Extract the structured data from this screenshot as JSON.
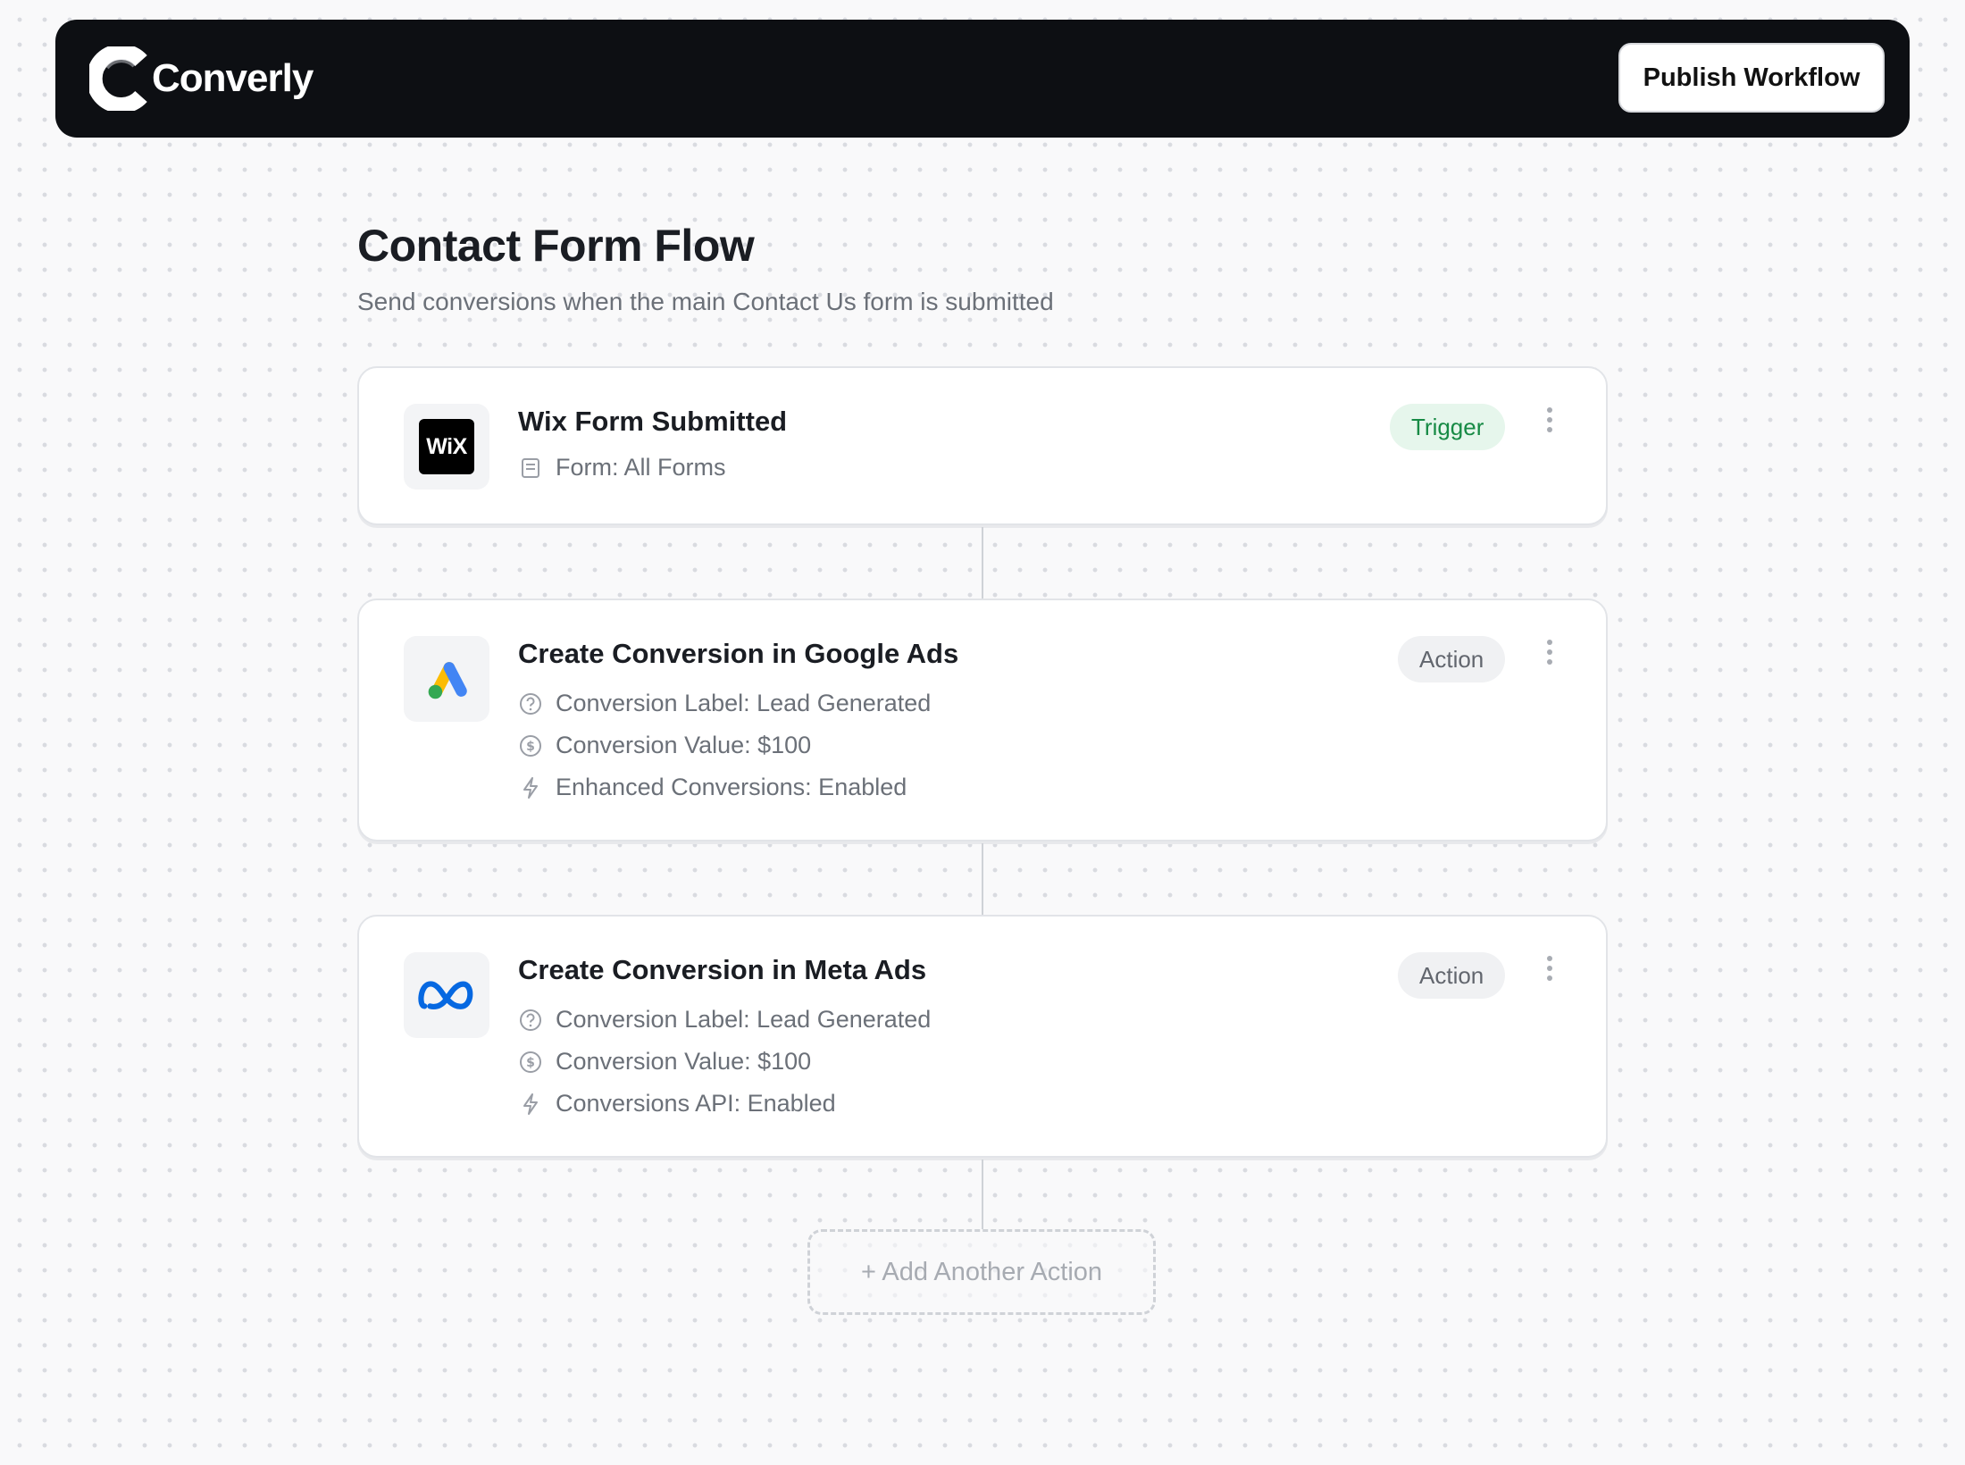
{
  "header": {
    "brand_name": "Converly",
    "publish_label": "Publish Workflow"
  },
  "workflow": {
    "title": "Contact Form Flow",
    "subtitle": "Send conversions when the main Contact Us form is submitted"
  },
  "steps": [
    {
      "title": "Wix Form Submitted",
      "badge": "Trigger",
      "logo": "wix-logo",
      "logo_text": "WiX",
      "details": [
        {
          "icon": "form-icon",
          "text": "Form: All Forms"
        }
      ]
    },
    {
      "title": "Create Conversion in Google Ads",
      "badge": "Action",
      "logo": "google-ads-logo",
      "details": [
        {
          "icon": "help-circle-icon",
          "text": "Conversion Label: Lead Generated"
        },
        {
          "icon": "dollar-circle-icon",
          "text": "Conversion Value: $100"
        },
        {
          "icon": "lightning-icon",
          "text": "Enhanced Conversions: Enabled"
        }
      ]
    },
    {
      "title": "Create Conversion in Meta Ads",
      "badge": "Action",
      "logo": "meta-logo",
      "details": [
        {
          "icon": "help-circle-icon",
          "text": "Conversion Label: Lead Generated"
        },
        {
          "icon": "dollar-circle-icon",
          "text": "Conversion Value: $100"
        },
        {
          "icon": "lightning-icon",
          "text": "Conversions API: Enabled"
        }
      ]
    }
  ],
  "add_action_label": "+ Add Another Action",
  "colors": {
    "header_bg": "#0d0f13",
    "trigger_badge_bg": "#e6f6ec",
    "trigger_badge_text": "#178a45",
    "action_badge_bg": "#f0f1f3",
    "google_blue": "#4285F4",
    "google_yellow": "#FBBC04",
    "google_green": "#34A853",
    "meta_blue": "#0668E1"
  }
}
